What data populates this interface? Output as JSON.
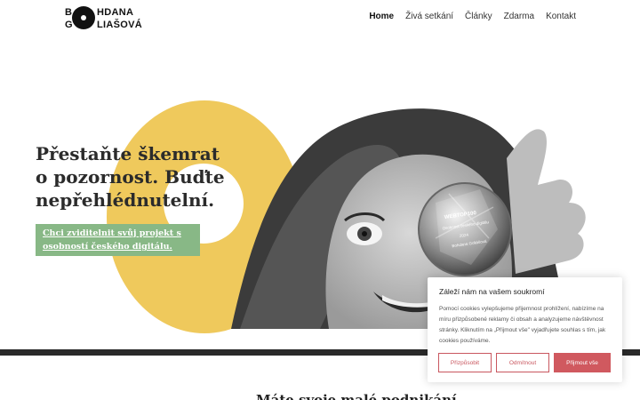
{
  "logo": {
    "b": "B",
    "first": "HDANA",
    "g": "G",
    "last": "LIAŠOVÁ"
  },
  "nav": {
    "items": [
      {
        "label": "Home",
        "active": true
      },
      {
        "label": "Živá setkání"
      },
      {
        "label": "Články"
      },
      {
        "label": "Zdarma"
      },
      {
        "label": "Kontakt"
      }
    ]
  },
  "hero": {
    "title": "Přestaňte škemrat o pozornost. Buďte nepřehlédnutelní.",
    "cta": "Chci zviditelnit svůj projekt s osobností českého digitálu. ",
    "award_text": [
      "WEBTOP100",
      "Osobnost českého digitálu",
      "2024",
      "Bohdana Goliášová"
    ]
  },
  "section": {
    "title": "Máte svoje malé podnikání"
  },
  "cookie": {
    "title": "Záleží nám na vašem soukromí",
    "text": "Pomocí cookies vylepšujeme přijemnost prohlížení, nabízíme na míru přizpůsobené reklamy či obsah a analyzujeme návštěvnost stránky. Kliknutím na „Přijmout vše\" vyjadřujete souhlas s tím, jak cookies používáme.",
    "customize": "Přizpůsobit",
    "reject": "Odmítnout",
    "accept": "Přijmout vše"
  },
  "colors": {
    "accent_yellow": "#efc95c",
    "cta_green": "#88b886",
    "cookie_red": "#d0595f",
    "dark": "#2a2a2a"
  }
}
